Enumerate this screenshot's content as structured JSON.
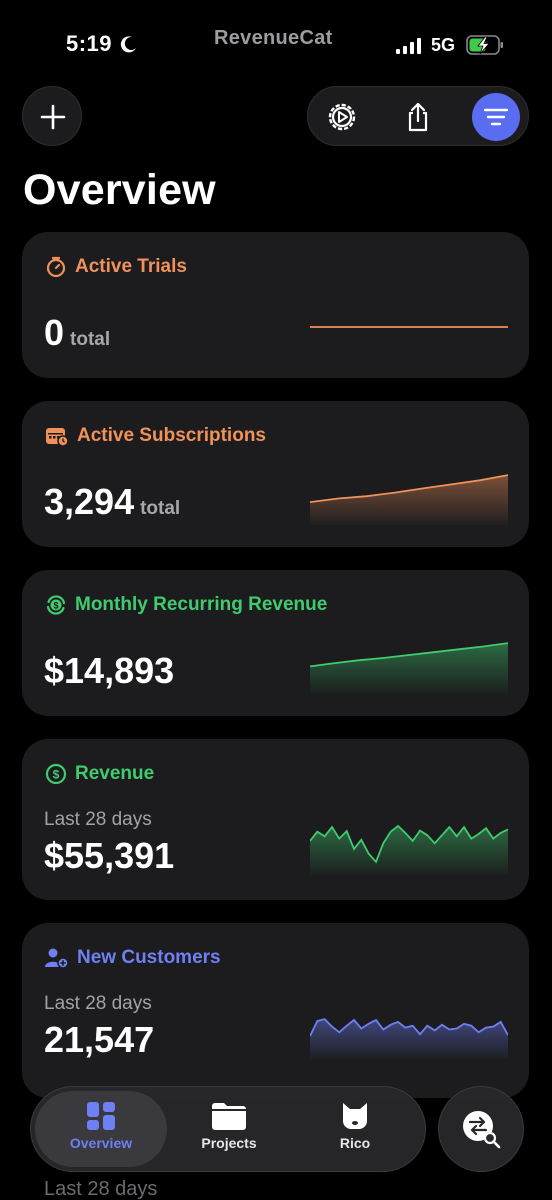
{
  "status_bar": {
    "time": "5:19",
    "brand": "RevenueCat",
    "network": "5G",
    "icons": [
      "moon-icon",
      "signal-icon",
      "battery-charging-icon"
    ]
  },
  "header": {
    "title": "Overview",
    "icons": [
      "plus-icon",
      "settings-icon",
      "share-icon",
      "filter-icon"
    ]
  },
  "colors": {
    "background": "#000000",
    "card": "#1c1c1e",
    "orange": "#f0915a",
    "green": "#3fcb6e",
    "blue": "#6f7ff4",
    "accent": "#5a6cf0"
  },
  "cards": {
    "trials": {
      "title": "Active Trials",
      "value": "0",
      "unit": "total",
      "icon": "timer-icon",
      "trend": [
        0,
        0,
        0,
        0,
        0,
        0,
        0,
        0
      ]
    },
    "subs": {
      "title": "Active Subscriptions",
      "value": "3,294",
      "unit": "total",
      "icon": "calendar-icon",
      "trend": [
        3180,
        3195,
        3205,
        3220,
        3238,
        3255,
        3272,
        3294
      ]
    },
    "mrr": {
      "title": "Monthly Recurring Revenue",
      "value": "$14,893",
      "icon": "recurring-dollar-icon",
      "trend": [
        14400,
        14470,
        14530,
        14580,
        14640,
        14700,
        14760,
        14820,
        14893
      ]
    },
    "revenue": {
      "title": "Revenue",
      "sublabel": "Last 28 days",
      "value": "$55,391",
      "icon": "dollar-circle-icon",
      "trend": [
        62,
        78,
        70,
        86,
        66,
        79,
        48,
        64,
        40,
        26,
        58,
        78,
        88,
        76,
        62,
        80,
        72,
        58,
        72,
        86,
        70,
        86,
        66,
        74,
        84,
        66,
        76,
        82
      ]
    },
    "customers": {
      "title": "New Customers",
      "sublabel": "Last 28 days",
      "value": "21,547",
      "icon": "user-add-icon",
      "trend": [
        40,
        72,
        76,
        60,
        48,
        62,
        74,
        56,
        66,
        74,
        54,
        64,
        70,
        58,
        62,
        44,
        62,
        52,
        64,
        54,
        56,
        66,
        62,
        48,
        58,
        60,
        70,
        42
      ]
    }
  },
  "tabbar": {
    "overview": "Overview",
    "projects": "Projects",
    "rico": "Rico"
  },
  "peek_text": "Last 28 days"
}
